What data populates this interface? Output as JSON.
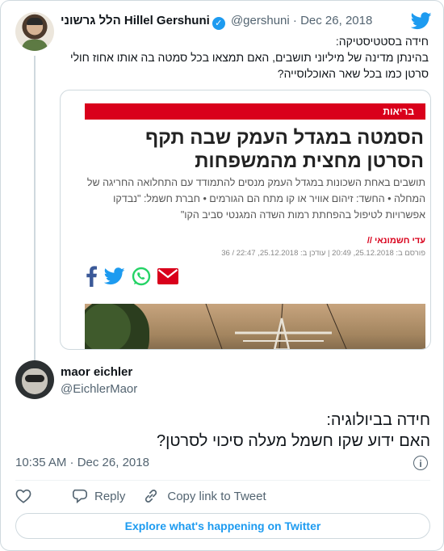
{
  "quoted": {
    "name": "הלל גרשוני Hillel Gershuni",
    "handle": "@gershuni",
    "separator": "·",
    "date": "Dec 26, 2018",
    "text": "חידה בסטטיסטיקה:\nבהינתן מדינה של מיליוני תושבים, האם תמצאו בכל סמטה בה אותו אחוז חולי\nסרטן כמו בכל שאר האוכלוסייה?",
    "card": {
      "category": "בריאות",
      "headline": "הסמטה במגדל העמק שבה תקף הסרטן מחצית מהמשפחות",
      "summary": "תושבים באחת השכונות במגדל העמק מנסים להתמודד עם התחלואה החריגה של המחלה • החשד: זיהום אוויר או קו מתח הם הגורמים • חברת חשמל: \"נבדקו אפשרויות לטיפול בהפחתת רמות השדה המגנטי סביב הקו\"",
      "author": "עדי חשמונאי //",
      "published": "פורסם ב: 25.12.2018, 20:49 | עודכן ב: 25.12.2018, 22:47 / 36"
    }
  },
  "main": {
    "name": "maor eichler",
    "handle": "@EichlerMaor",
    "text": "חידה בביולוגיה:\nהאם ידוע שקו חשמל מעלה סיכוי לסרטן?",
    "timestamp": "10:35 AM · Dec 26, 2018",
    "info_icon": "i"
  },
  "actions": {
    "reply": "Reply",
    "copy_link": "Copy link to Tweet"
  },
  "explore": "Explore what's happening on Twitter",
  "colors": {
    "twitter_blue": "#1d9bf0",
    "text_secondary": "#536471",
    "border": "#cfd9de",
    "ynet_red": "#d9001b"
  }
}
